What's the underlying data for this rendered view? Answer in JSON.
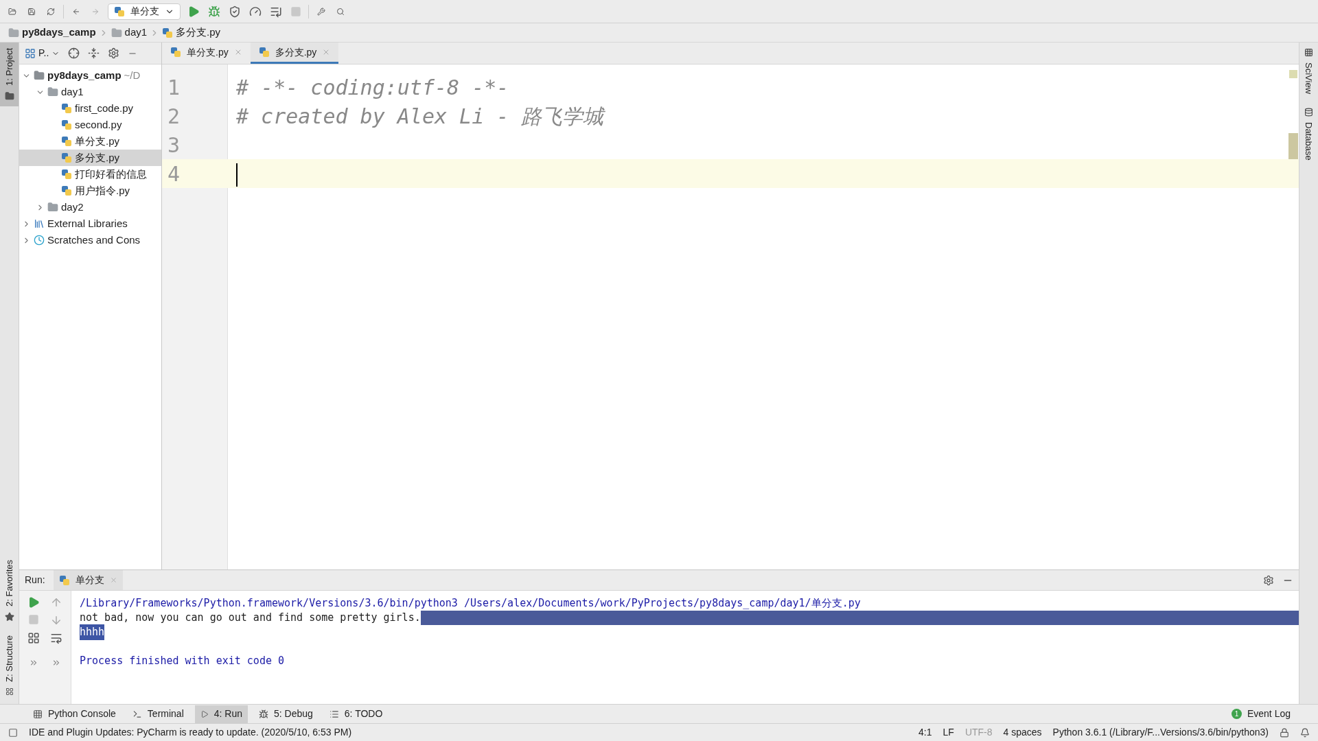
{
  "toolbar": {
    "run_config": "单分支"
  },
  "breadcrumbs": [
    {
      "kind": "project",
      "label": "py8days_camp"
    },
    {
      "kind": "folder",
      "label": "day1"
    },
    {
      "kind": "file",
      "label": "多分支.py"
    }
  ],
  "left_stripe": {
    "top": [
      {
        "label": "1: Project",
        "selected": true
      }
    ],
    "bottom": [
      {
        "label": "2: Favorites",
        "selected": false
      },
      {
        "label": "Z: Structure",
        "selected": false
      }
    ]
  },
  "right_stripe": [
    {
      "label": "SciView"
    },
    {
      "label": "Database"
    }
  ],
  "project_panel": {
    "title": "P..",
    "tree": [
      {
        "kind": "project",
        "label": "py8days_camp",
        "hint": "~/D",
        "expanded": true,
        "selected": false,
        "children": [
          {
            "kind": "folder",
            "label": "day1",
            "expanded": true,
            "selected": false,
            "children": [
              {
                "kind": "file",
                "label": "first_code.py",
                "selected": false
              },
              {
                "kind": "file",
                "label": "second.py",
                "selected": false
              },
              {
                "kind": "file",
                "label": "单分支.py",
                "selected": false
              },
              {
                "kind": "file",
                "label": "多分支.py",
                "selected": true
              },
              {
                "kind": "file",
                "label": "打印好看的信息",
                "selected": false
              },
              {
                "kind": "file",
                "label": "用户指令.py",
                "selected": false
              }
            ]
          },
          {
            "kind": "folder",
            "label": "day2",
            "expanded": false,
            "selected": false
          }
        ]
      },
      {
        "kind": "libraries",
        "label": "External Libraries",
        "expanded": false,
        "selected": false
      },
      {
        "kind": "scratches",
        "label": "Scratches and Cons",
        "expanded": false,
        "selected": false
      }
    ]
  },
  "editor_tabs": [
    {
      "label": "单分支.py",
      "selected": false
    },
    {
      "label": "多分支.py",
      "selected": true
    }
  ],
  "editor": {
    "lines": [
      {
        "number": "1",
        "text": "# -*- coding:utf-8 -*-",
        "current": false
      },
      {
        "number": "2",
        "text": "# created by Alex Li - 路飞学城",
        "current": false
      },
      {
        "number": "3",
        "current": false
      },
      {
        "number": "4",
        "current": true
      }
    ]
  },
  "run_panel": {
    "label": "Run:",
    "tab": "单分支",
    "console": [
      {
        "kind": "command",
        "text": "/Library/Frameworks/Python.framework/Versions/3.6/bin/python3 /Users/alex/Documents/work/PyProjects/py8days_camp/day1/单分支.py",
        "selected": false,
        "highlight_to_end": false
      },
      {
        "kind": "output",
        "text": "not bad, now you can go out and find some pretty girls.",
        "selected": false,
        "highlight_to_end": true
      },
      {
        "kind": "output",
        "text": "hhhh",
        "selected": true,
        "highlight_to_end": false
      },
      {
        "kind": "gap"
      },
      {
        "kind": "exit",
        "text": "Process finished with exit code 0",
        "selected": false,
        "highlight_to_end": false
      }
    ]
  },
  "tool_tabs": [
    {
      "kind": "console",
      "label": "Python Console",
      "selected": false
    },
    {
      "kind": "terminal",
      "label": "Terminal",
      "selected": false
    },
    {
      "kind": "run",
      "label": "4: Run",
      "selected": true
    },
    {
      "kind": "debug",
      "label": "5: Debug",
      "selected": false
    },
    {
      "kind": "todo",
      "label": "6: TODO",
      "selected": false
    }
  ],
  "event_log": {
    "label": "Event Log",
    "count": "1"
  },
  "status_bar": {
    "message": "IDE and Plugin Updates: PyCharm is ready to update. (2020/5/10, 6:53 PM)",
    "items": [
      {
        "text": "4:1",
        "disabled": false
      },
      {
        "text": "LF",
        "disabled": false
      },
      {
        "text": "UTF-8",
        "disabled": true
      },
      {
        "text": "4 spaces",
        "disabled": false
      },
      {
        "text": "Python 3.6.1 (/Library/F...Versions/3.6/bin/python3)",
        "disabled": false
      }
    ]
  }
}
